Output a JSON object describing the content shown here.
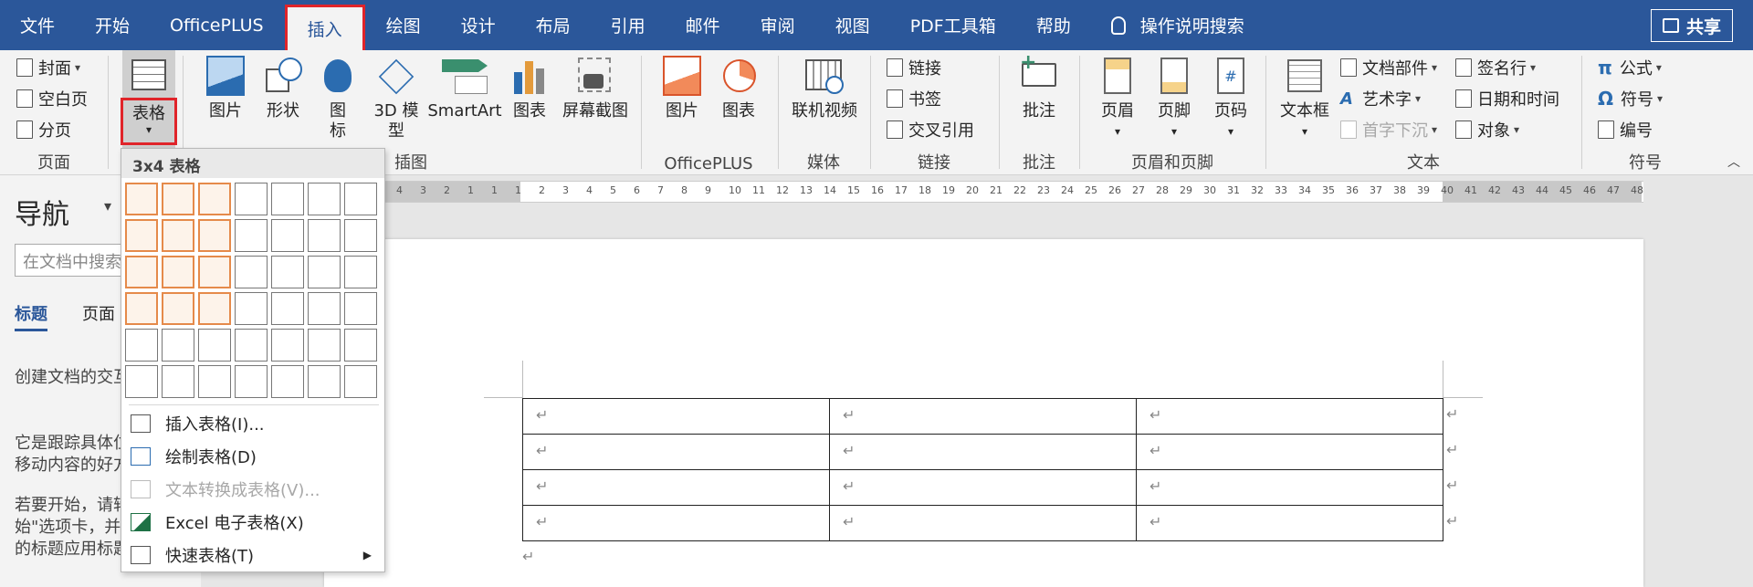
{
  "tabs": [
    "文件",
    "开始",
    "OfficePLUS",
    "插入",
    "绘图",
    "设计",
    "布局",
    "引用",
    "邮件",
    "审阅",
    "视图",
    "PDF工具箱",
    "帮助",
    "操作说明搜索"
  ],
  "share_label": "共享",
  "ribbon": {
    "pages": {
      "cover": "封面",
      "blank": "空白页",
      "break": "分页",
      "label": "页面"
    },
    "table": {
      "label": "表格"
    },
    "illustrations": {
      "picture": "图片",
      "shapes": "形状",
      "icons_1": "图",
      "icons_2": "标",
      "model_1": "3D 模",
      "model_2": "型",
      "smartart": "SmartArt",
      "chart": "图表",
      "screenshot": "屏幕截图",
      "label": "插图"
    },
    "officeplus": {
      "picture": "图片",
      "chart": "图表",
      "label": "OfficePLUS"
    },
    "media": {
      "video": "联机视频",
      "label": "媒体"
    },
    "links": {
      "link": "链接",
      "bookmark": "书签",
      "crossref": "交叉引用",
      "label": "链接"
    },
    "comments": {
      "comment": "批注",
      "label": "批注"
    },
    "header_footer": {
      "header": "页眉",
      "footer": "页脚",
      "page_number": "页码",
      "label": "页眉和页脚"
    },
    "text": {
      "textbox": "文本框",
      "quickparts": "文档部件",
      "wordart": "艺术字",
      "dropcap": "首字下沉",
      "signature": "签名行",
      "datetime": "日期和时间",
      "object": "对象",
      "label": "文本"
    },
    "symbols": {
      "equation": "公式",
      "symbol": "符号",
      "number": "编号",
      "label": "符号"
    }
  },
  "nav": {
    "title": "导航",
    "search_placeholder": "在文档中搜索",
    "tab_headings": "标题",
    "tab_pages": "页面",
    "p1": "创建文档的交互式大纲。",
    "p2": "它是跟踪具体位置和快速移动内容的好方法。",
    "p3": "若要开始，请转到\"开始\"选项卡，并向文档中的标题应用标题样式。"
  },
  "ruler_ticks": [
    "4",
    "3",
    "2",
    "1",
    "1",
    "1",
    "2",
    "3",
    "4",
    "5",
    "6",
    "7",
    "8",
    "9",
    "10",
    "11",
    "12",
    "13",
    "14",
    "15",
    "16",
    "17",
    "18",
    "19",
    "20",
    "21",
    "22",
    "23",
    "24",
    "25",
    "26",
    "27",
    "28",
    "29",
    "30",
    "31",
    "32",
    "33",
    "34",
    "35",
    "36",
    "37",
    "38",
    "39",
    "40",
    "41",
    "42",
    "43",
    "44",
    "45",
    "46",
    "47",
    "48"
  ],
  "dropdown": {
    "header": "3x4 表格",
    "grid_cols": 7,
    "grid_rows": 6,
    "sel_cols": 3,
    "sel_rows": 4,
    "items": [
      {
        "label": "插入表格(I)...",
        "disabled": false
      },
      {
        "label": "绘制表格(D)",
        "disabled": false
      },
      {
        "label": "文本转换成表格(V)...",
        "disabled": true
      },
      {
        "label": "Excel 电子表格(X)",
        "disabled": false
      },
      {
        "label": "快速表格(T)",
        "disabled": false
      }
    ]
  },
  "doc_table": {
    "rows": 4,
    "cols": 3,
    "mark": "↵"
  },
  "colors": {
    "accent": "#2b579a",
    "highlight": "#e0242a",
    "grid_sel": "#e58a4a"
  }
}
